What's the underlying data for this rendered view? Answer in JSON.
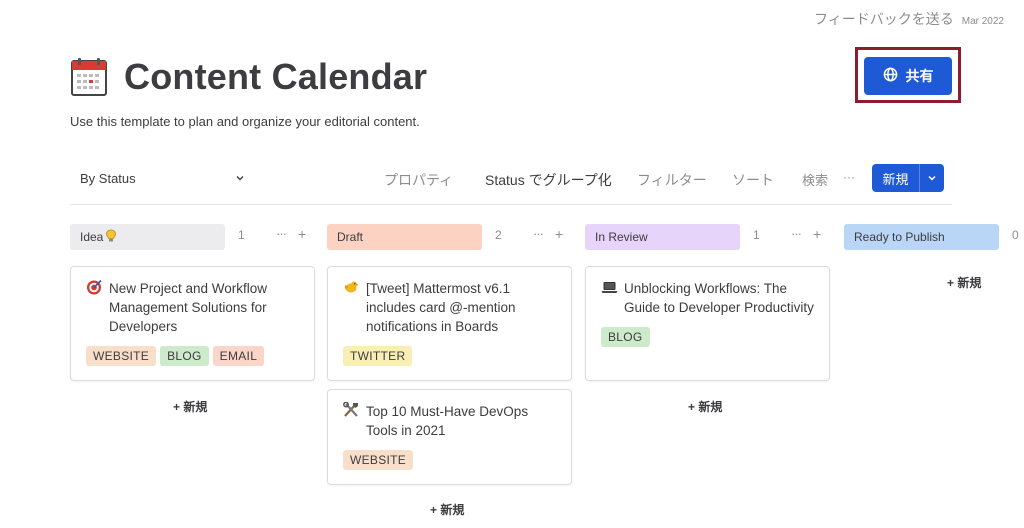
{
  "header": {
    "feedback_label": "フィードバックを送る",
    "date": "Mar 2022",
    "title": "Content Calendar",
    "subtitle": "Use this template to plan and organize your editorial content.",
    "share_label": "共有"
  },
  "toolbar": {
    "view_label": "By Status",
    "properties_label": "プロパティ",
    "group_by_label": "Status でグループ化",
    "filter_label": "フィルター",
    "sort_label": "ソート",
    "search_label": "検索",
    "more_label": "···",
    "new_label": "新規"
  },
  "columns": [
    {
      "name": "Idea",
      "count": "1",
      "color": "#ececee",
      "more": "···",
      "add": "+",
      "cards": [
        {
          "title": "New Project and Workflow Management Solutions for Developers",
          "icon": "target-icon",
          "tags": [
            "WEBSITE",
            "BLOG",
            "EMAIL"
          ]
        }
      ],
      "add_new": "+ 新規"
    },
    {
      "name": "Draft",
      "count": "2",
      "color": "#fcd2c2",
      "more": "···",
      "add": "+",
      "cards": [
        {
          "title": "[Tweet] Mattermost v6.1 includes card @-mention notifications in Boards",
          "icon": "bird-icon",
          "tags": [
            "TWITTER"
          ]
        },
        {
          "title": "Top 10 Must-Have DevOps Tools in 2021",
          "icon": "tools-icon",
          "tags": [
            "WEBSITE"
          ]
        }
      ],
      "add_new": "+ 新規"
    },
    {
      "name": "In Review",
      "count": "1",
      "color": "#e6d4fb",
      "more": "···",
      "add": "+",
      "cards": [
        {
          "title": "Unblocking Workflows: The Guide to Developer Productivity",
          "icon": "laptop-icon",
          "tags": [
            "BLOG"
          ]
        }
      ],
      "add_new": "+ 新規"
    },
    {
      "name": "Ready to Publish",
      "count": "0",
      "color": "#b9d6f6",
      "cards": [],
      "add_new": "+ 新規"
    }
  ],
  "accent_color": "#1e59d6"
}
